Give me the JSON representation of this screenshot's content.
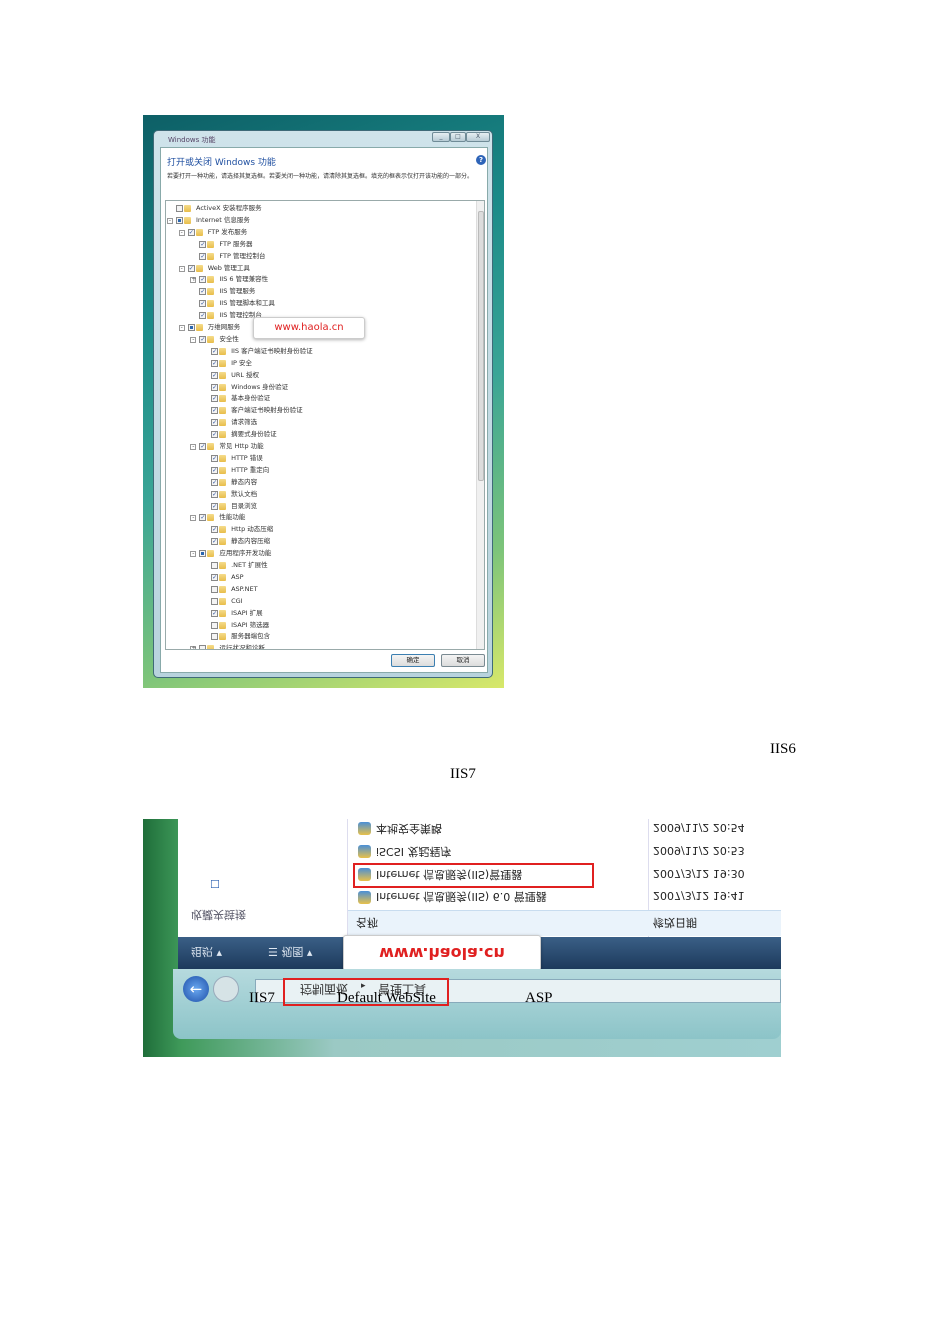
{
  "dialog": {
    "title": "Windows 功能",
    "heading": "打开或关闭 Windows 功能",
    "help_icon": "?",
    "description": "若要打开一种功能，请选择其复选框。若要关闭一种功能，请清除其复选框。填充的框表示仅打开该功能的一部分。",
    "window_buttons": [
      "_",
      "□",
      "X"
    ],
    "tree": [
      {
        "label": "ActiveX 安装程序服务",
        "level": 0,
        "state": "unchecked",
        "expander": ""
      },
      {
        "label": "Internet 信息服务",
        "level": 0,
        "state": "partial",
        "expander": "-"
      },
      {
        "label": "FTP 发布服务",
        "level": 1,
        "state": "checked",
        "expander": "-"
      },
      {
        "label": "FTP 服务器",
        "level": 2,
        "state": "checked",
        "expander": ""
      },
      {
        "label": "FTP 管理控制台",
        "level": 2,
        "state": "checked",
        "expander": ""
      },
      {
        "label": "Web 管理工具",
        "level": 1,
        "state": "checked",
        "expander": "-"
      },
      {
        "label": "IIS 6 管理兼容性",
        "level": 2,
        "state": "checked",
        "expander": "+"
      },
      {
        "label": "IIS 管理服务",
        "level": 2,
        "state": "checked",
        "expander": ""
      },
      {
        "label": "IIS 管理脚本和工具",
        "level": 2,
        "state": "checked",
        "expander": ""
      },
      {
        "label": "IIS 管理控制台",
        "level": 2,
        "state": "checked",
        "expander": ""
      },
      {
        "label": "万维网服务",
        "level": 1,
        "state": "partial",
        "expander": "-"
      },
      {
        "label": "安全性",
        "level": 2,
        "state": "checked",
        "expander": "-"
      },
      {
        "label": "IIS 客户端证书映射身份验证",
        "level": 3,
        "state": "checked",
        "expander": ""
      },
      {
        "label": "IP 安全",
        "level": 3,
        "state": "checked",
        "expander": ""
      },
      {
        "label": "URL 授权",
        "level": 3,
        "state": "checked",
        "expander": ""
      },
      {
        "label": "Windows 身份验证",
        "level": 3,
        "state": "checked",
        "expander": ""
      },
      {
        "label": "基本身份验证",
        "level": 3,
        "state": "checked",
        "expander": ""
      },
      {
        "label": "客户端证书映射身份验证",
        "level": 3,
        "state": "checked",
        "expander": ""
      },
      {
        "label": "请求筛选",
        "level": 3,
        "state": "checked",
        "expander": ""
      },
      {
        "label": "摘要式身份验证",
        "level": 3,
        "state": "checked",
        "expander": ""
      },
      {
        "label": "常见 Http 功能",
        "level": 2,
        "state": "checked",
        "expander": "-"
      },
      {
        "label": "HTTP 错误",
        "level": 3,
        "state": "checked",
        "expander": ""
      },
      {
        "label": "HTTP 重定向",
        "level": 3,
        "state": "checked",
        "expander": ""
      },
      {
        "label": "静态内容",
        "level": 3,
        "state": "checked",
        "expander": ""
      },
      {
        "label": "默认文档",
        "level": 3,
        "state": "checked",
        "expander": ""
      },
      {
        "label": "目录浏览",
        "level": 3,
        "state": "checked",
        "expander": ""
      },
      {
        "label": "性能功能",
        "level": 2,
        "state": "checked",
        "expander": "-"
      },
      {
        "label": "Http 动态压缩",
        "level": 3,
        "state": "checked",
        "expander": ""
      },
      {
        "label": "静态内容压缩",
        "level": 3,
        "state": "checked",
        "expander": ""
      },
      {
        "label": "应用程序开发功能",
        "level": 2,
        "state": "partial",
        "expander": "-"
      },
      {
        "label": ".NET 扩展性",
        "level": 3,
        "state": "unchecked",
        "expander": ""
      },
      {
        "label": "ASP",
        "level": 3,
        "state": "checked",
        "expander": ""
      },
      {
        "label": "ASP.NET",
        "level": 3,
        "state": "unchecked",
        "expander": ""
      },
      {
        "label": "CGI",
        "level": 3,
        "state": "unchecked",
        "expander": ""
      },
      {
        "label": "ISAPI 扩展",
        "level": 3,
        "state": "checked",
        "expander": ""
      },
      {
        "label": "ISAPI 筛选器",
        "level": 3,
        "state": "unchecked",
        "expander": ""
      },
      {
        "label": "服务器端包含",
        "level": 3,
        "state": "unchecked",
        "expander": ""
      },
      {
        "label": "运行状况和诊断",
        "level": 2,
        "state": "unchecked",
        "expander": "+"
      }
    ],
    "ok_label": "确定",
    "cancel_label": "取消",
    "watermark": "www.haola.cn"
  },
  "doc": {
    "label_iis6": "IIS6",
    "label_iis7": "IIS7"
  },
  "explorer": {
    "rows": [
      {
        "name": "本地安全策略",
        "date": "2009/11/2 20:54"
      },
      {
        "name": "iSCSI 发起程序",
        "date": "2009/11/2 20:53"
      },
      {
        "name": "Internet 信息服务(IIS)管理器",
        "date": "2007/3/12 19:30"
      },
      {
        "name": "Internet 信息服务(IIS) 6.0 管理器",
        "date": "2007/3/12 19:41"
      }
    ],
    "col_name": "名称",
    "col_date": "修改日期",
    "favorites": "收藏夹链接",
    "organize": "组织",
    "views": "视图",
    "breadcrumb": [
      "控制面板",
      "管理工具"
    ],
    "watermark": "www.haola.cn",
    "overlay": [
      "IIS7",
      "Default WebSite",
      "ASP"
    ]
  }
}
